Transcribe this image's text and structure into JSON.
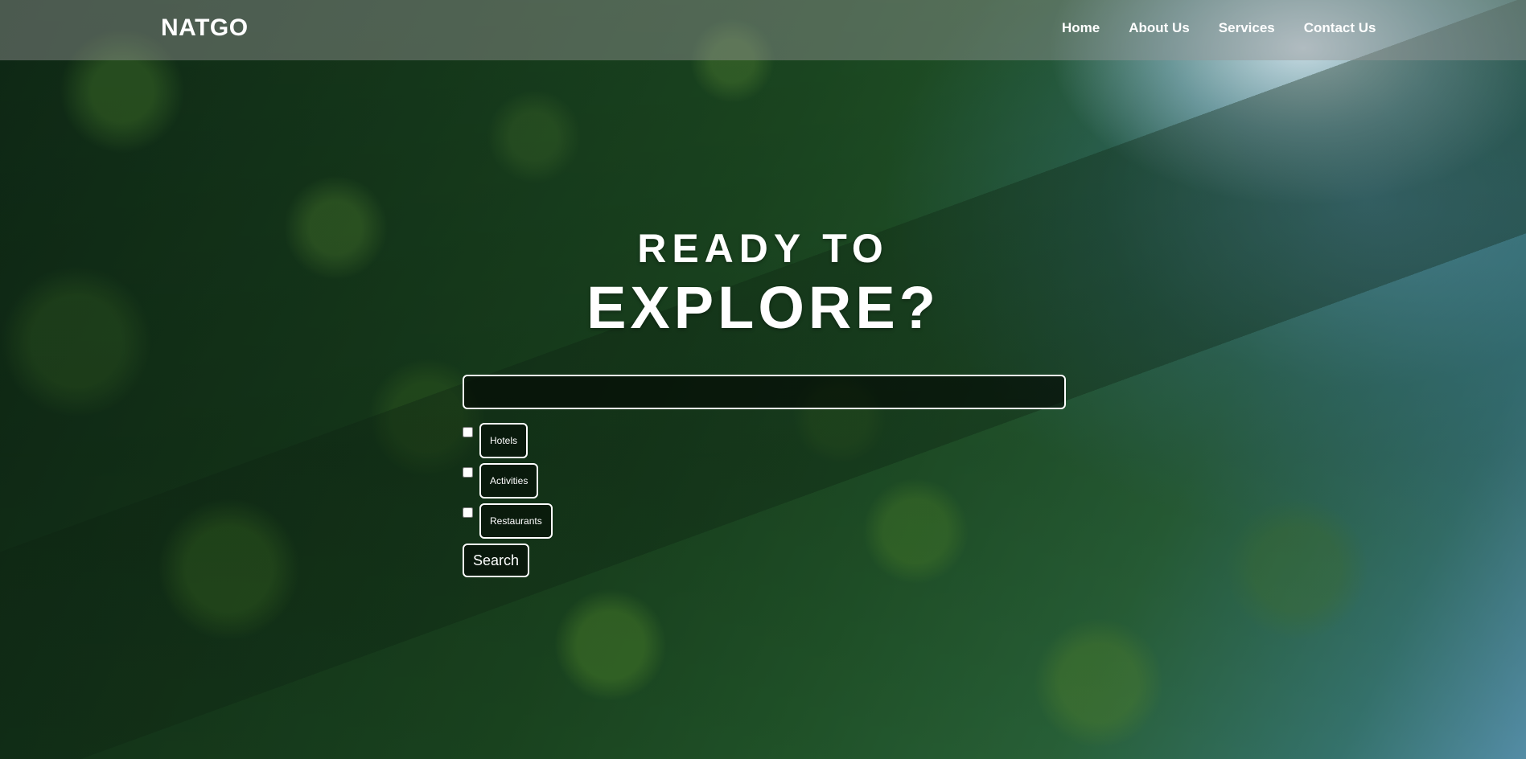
{
  "navbar": {
    "logo": "NATGO",
    "links": [
      {
        "label": "Home"
      },
      {
        "label": "About Us"
      },
      {
        "label": "Services"
      },
      {
        "label": "Contact Us"
      }
    ]
  },
  "hero": {
    "headline_line1": "READY TO",
    "headline_line2": "EXPLORE?",
    "search": {
      "value": "",
      "placeholder": ""
    },
    "filters": [
      {
        "label": "Hotels",
        "checked": false
      },
      {
        "label": "Activities",
        "checked": false
      },
      {
        "label": "Restaurants",
        "checked": false
      }
    ],
    "search_button_label": "Search"
  },
  "colors": {
    "text": "#ffffff",
    "navbar_bg": "#969696",
    "forest_dark": "#163b1c",
    "sky_blue": "#5d9cb8"
  }
}
